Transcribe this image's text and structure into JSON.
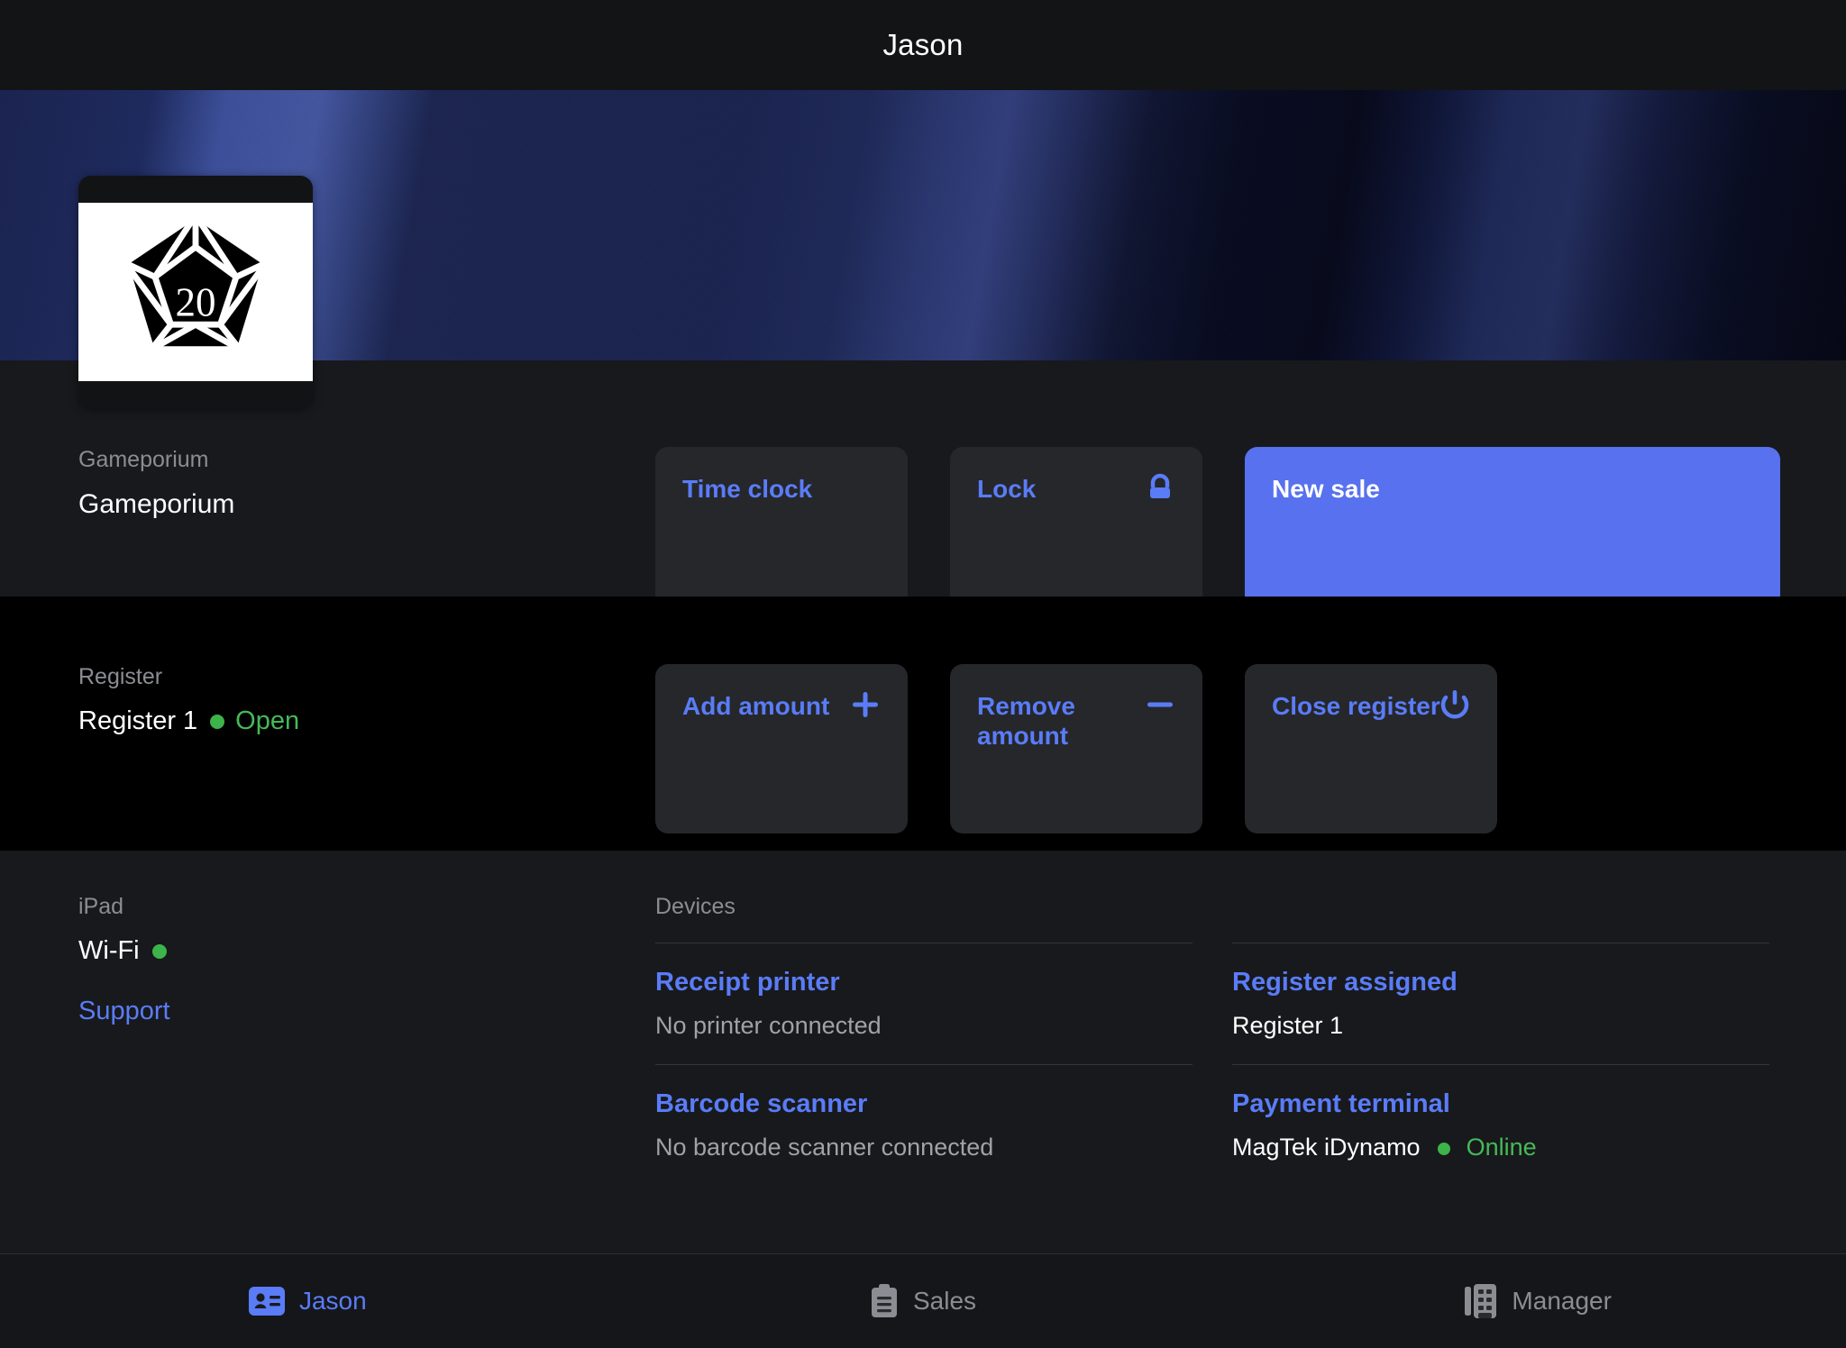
{
  "window": {
    "title": "Jason"
  },
  "store": {
    "label": "Gameporium",
    "name": "Gameporium",
    "logo_icon": "d20-dice-icon",
    "logo_number": "20"
  },
  "store_actions": [
    {
      "label": "Time clock",
      "icon": "",
      "name": "time-clock"
    },
    {
      "label": "Lock",
      "icon": "lock-icon",
      "name": "lock"
    },
    {
      "label": "New sale",
      "icon": "",
      "name": "new-sale",
      "primary": true
    }
  ],
  "register": {
    "label": "Register",
    "name": "Register 1",
    "status": "Open",
    "status_color": "#46b957",
    "actions": [
      {
        "label": "Add amount",
        "icon": "plus-icon",
        "name": "add-amount"
      },
      {
        "label": "Remove amount",
        "icon": "minus-icon",
        "name": "remove-amount"
      },
      {
        "label": "Close register",
        "icon": "power-icon",
        "name": "close-register"
      }
    ]
  },
  "device_info": {
    "label": "iPad",
    "connection": "Wi-Fi",
    "connection_status_color": "#3cb44a",
    "support_label": "Support"
  },
  "devices": {
    "heading": "Devices",
    "items": [
      {
        "title": "Receipt printer",
        "sub": "No printer connected"
      },
      {
        "title": "Barcode scanner",
        "sub": "No barcode scanner connected"
      }
    ]
  },
  "assignments": {
    "items": [
      {
        "title": "Register assigned",
        "sub": "Register 1",
        "status": "",
        "bright": true
      },
      {
        "title": "Payment terminal",
        "sub": "MagTek iDynamo",
        "status": "Online",
        "bright": true
      }
    ]
  },
  "tabs": [
    {
      "label": "Jason",
      "icon": "id-card-icon",
      "active": true
    },
    {
      "label": "Sales",
      "icon": "clipboard-icon",
      "active": false
    },
    {
      "label": "Manager",
      "icon": "building-icon",
      "active": false
    }
  ],
  "colors": {
    "accent": "#5a7cf7",
    "primary_button": "#5871ef",
    "online": "#46b957",
    "background": "#18191c",
    "register_background": "#000000"
  }
}
